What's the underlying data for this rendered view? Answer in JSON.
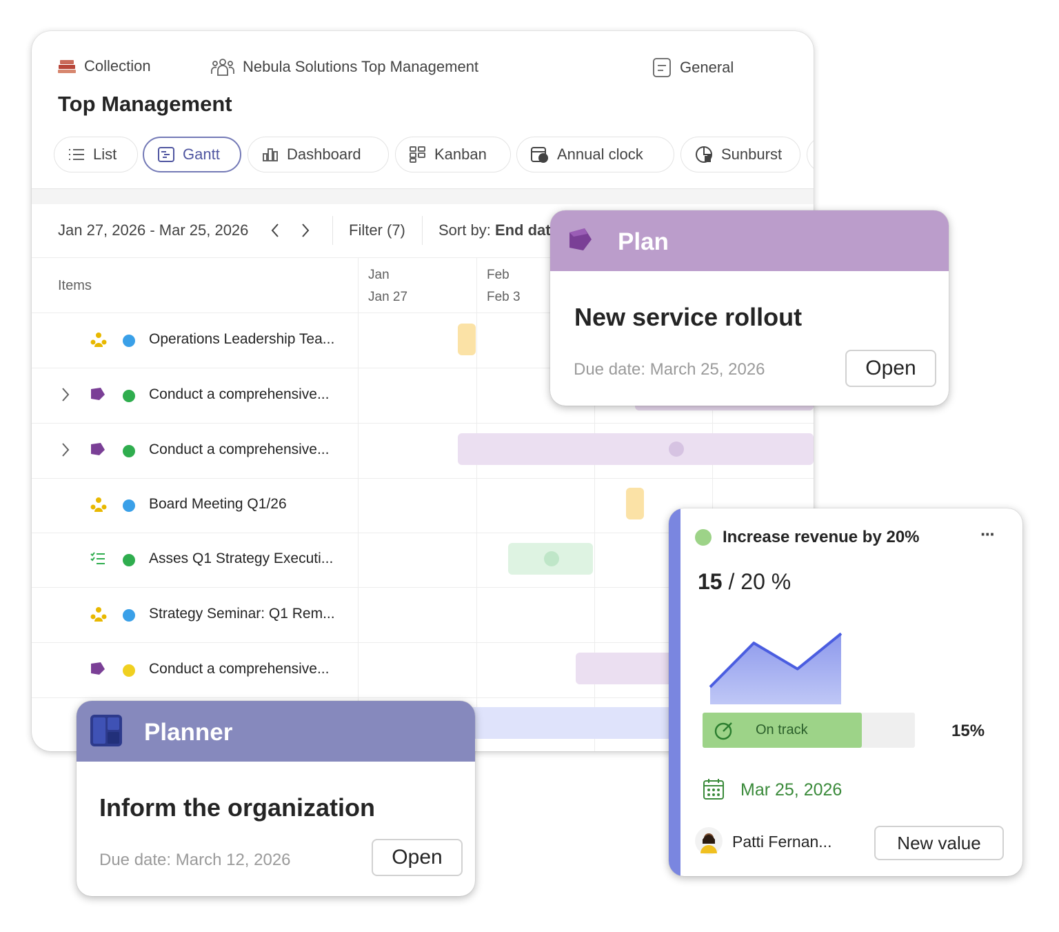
{
  "header": {
    "collection_label": "Collection",
    "team_label": "Nebula Solutions Top Management",
    "channel_label": "General",
    "title": "Top Management"
  },
  "tabs": [
    {
      "label": "List",
      "icon": "list-icon"
    },
    {
      "label": "Gantt",
      "icon": "gantt-icon",
      "active": true
    },
    {
      "label": "Dashboard",
      "icon": "dashboard-icon"
    },
    {
      "label": "Kanban",
      "icon": "kanban-icon"
    },
    {
      "label": "Annual clock",
      "icon": "annual-clock-icon"
    },
    {
      "label": "Sunburst",
      "icon": "sunburst-icon"
    }
  ],
  "toolbar": {
    "date_range": "Jan 27, 2026 - Mar 25, 2026",
    "filter_label": "Filter (7)",
    "sort_prefix": "Sort by:",
    "sort_value": "End dat"
  },
  "grid": {
    "items_label": "Items",
    "columns": [
      {
        "month": "Jan",
        "day": "Jan 27"
      },
      {
        "month": "Feb",
        "day": "Feb 3"
      }
    ],
    "rows": [
      {
        "name": "Operations Leadership Tea...",
        "icon": "meeting-icon",
        "status_color": "#3aa0e8",
        "expandable": false
      },
      {
        "name": "Conduct a comprehensive...",
        "icon": "plan-tag-icon",
        "status_color": "#2fad4e",
        "expandable": true
      },
      {
        "name": "Conduct a comprehensive...",
        "icon": "plan-tag-icon",
        "status_color": "#2fad4e",
        "expandable": true
      },
      {
        "name": "Board Meeting Q1/26",
        "icon": "meeting-icon",
        "status_color": "#3aa0e8",
        "expandable": false
      },
      {
        "name": "Asses Q1 Strategy Executi...",
        "icon": "checklist-icon",
        "status_color": "#2fad4e",
        "expandable": false
      },
      {
        "name": "Strategy Seminar: Q1 Rem...",
        "icon": "meeting-icon",
        "status_color": "#3aa0e8",
        "expandable": false
      },
      {
        "name": "Conduct a comprehensive...",
        "icon": "plan-tag-icon",
        "status_color": "#f0d020",
        "expandable": false
      }
    ]
  },
  "plan_card": {
    "header": "Plan",
    "title": "New service rollout",
    "due": "Due date: March 25, 2026",
    "button": "Open",
    "color": "#bb9dcb"
  },
  "planner_card": {
    "header": "Planner",
    "title": "Inform the organization",
    "due": "Due date: March 12, 2026",
    "button": "Open",
    "color": "#8689bd"
  },
  "goal_card": {
    "title": "Increase revenue by 20%",
    "more": "···",
    "current": "15",
    "target": "/ 20 %",
    "status_label": "On track",
    "progress": 0.75,
    "percent_label": "15%",
    "date": "Mar 25, 2026",
    "owner": "Patti Fernan...",
    "button": "New value",
    "status_color": "#9dd388",
    "accent_color": "#7a86e0",
    "sparkline": [
      0.22,
      0.78,
      0.45,
      0.9
    ]
  }
}
